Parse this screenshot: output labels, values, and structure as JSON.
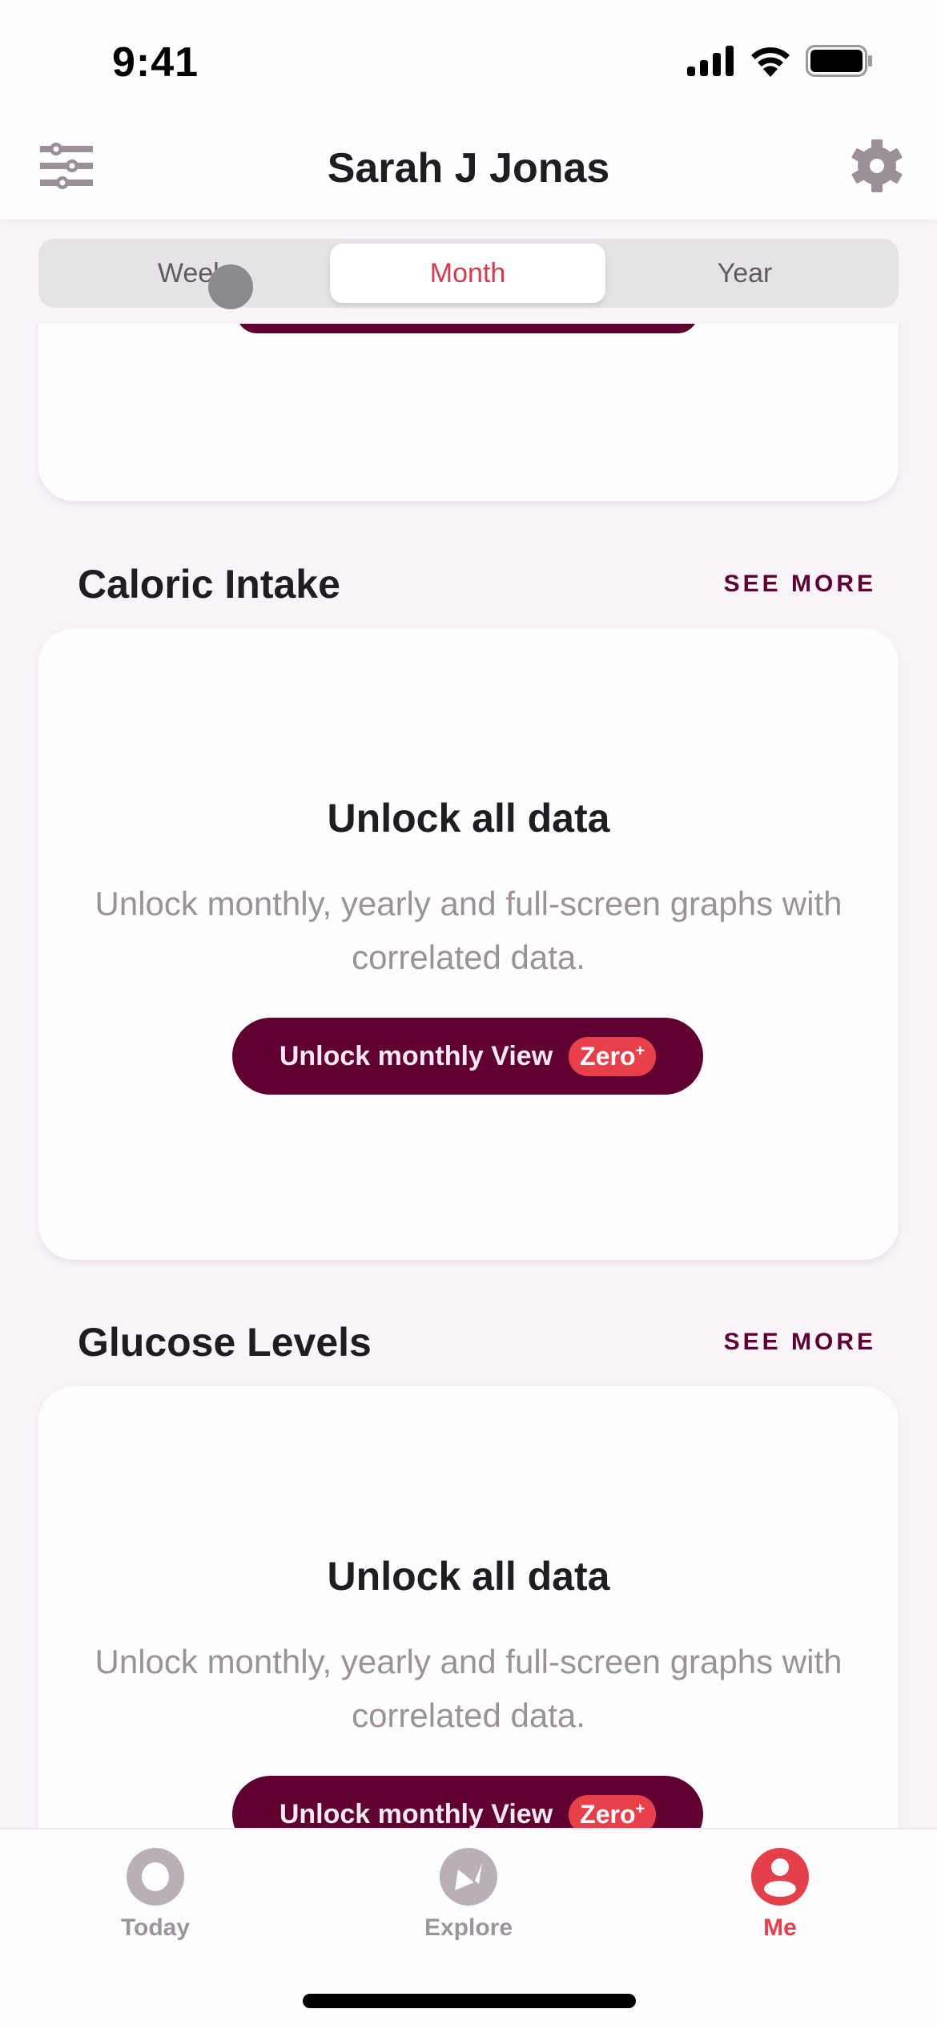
{
  "status_bar": {
    "time": "9:41"
  },
  "header": {
    "title": "Sarah J Jonas",
    "left_icon": "sliders-icon",
    "right_icon": "gear-icon"
  },
  "segmented_control": {
    "options": [
      "Week",
      "Month",
      "Year"
    ],
    "selected": "Month"
  },
  "sections": [
    {
      "title": "Caloric Intake",
      "see_more": "SEE MORE",
      "card": {
        "title": "Unlock all data",
        "description": "Unlock monthly, yearly and full-screen graphs with correlated data.",
        "button_label": "Unlock monthly View",
        "badge": "Zero",
        "badge_sup": "+"
      }
    },
    {
      "title": "Glucose Levels",
      "see_more": "SEE MORE",
      "card": {
        "title": "Unlock all data",
        "description": "Unlock monthly, yearly and full-screen graphs with correlated data.",
        "button_label": "Unlock monthly View",
        "badge": "Zero",
        "badge_sup": "+"
      }
    }
  ],
  "tab_bar": {
    "items": [
      {
        "label": "Today",
        "icon": "circle-ring-icon",
        "active": false
      },
      {
        "label": "Explore",
        "icon": "compass-icon",
        "active": false
      },
      {
        "label": "Me",
        "icon": "profile-icon",
        "active": true
      }
    ]
  },
  "colors": {
    "brand": "#5f0030",
    "accent": "#e53f4a",
    "selected_segment_text": "#d93848",
    "inactive_icon": "#b8b0b6",
    "background": "#f8f4f8"
  }
}
